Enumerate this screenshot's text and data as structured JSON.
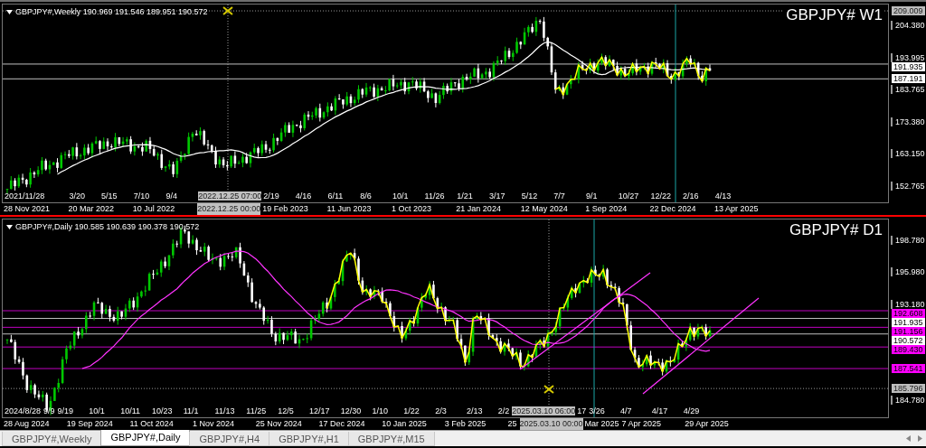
{
  "panels": [
    {
      "header": "GBPJPY#,Weekly 190.969 191.546 189.951 190.572",
      "symbol": "GBPJPY# W1",
      "active": false,
      "price_labels": [
        {
          "text": "209.009",
          "kind": "marker"
        },
        {
          "text": "204.380",
          "kind": "tick"
        },
        {
          "text": "193.995",
          "kind": "tick"
        },
        {
          "text": "191.935",
          "kind": "level",
          "color": "#ffffff"
        },
        {
          "text": "187.191",
          "kind": "level",
          "color": "#ffffff"
        },
        {
          "text": "183.765",
          "kind": "tick"
        },
        {
          "text": "173.380",
          "kind": "tick"
        },
        {
          "text": "163.150",
          "kind": "tick"
        },
        {
          "text": "152.765",
          "kind": "tick"
        }
      ],
      "inner_dates": [
        {
          "text": "2021/11/28",
          "kind": "wide"
        },
        {
          "text": "3/20",
          "kind": "date"
        },
        {
          "text": "5/15",
          "kind": "date"
        },
        {
          "text": "7/10",
          "kind": "date"
        },
        {
          "text": "9/4",
          "kind": "date"
        },
        {
          "text": "2022.12.25 07:00",
          "kind": "crosshair"
        },
        {
          "text": "2/19",
          "kind": "date"
        },
        {
          "text": "4/16",
          "kind": "date"
        },
        {
          "text": "6/11",
          "kind": "date"
        },
        {
          "text": "8/6",
          "kind": "date"
        },
        {
          "text": "10/1",
          "kind": "date"
        },
        {
          "text": "11/26",
          "kind": "date"
        },
        {
          "text": "1/21",
          "kind": "date"
        },
        {
          "text": "3/17",
          "kind": "date"
        },
        {
          "text": "5/12",
          "kind": "date"
        },
        {
          "text": "7/7",
          "kind": "date"
        },
        {
          "text": "9/1",
          "kind": "date"
        },
        {
          "text": "10/27",
          "kind": "date"
        },
        {
          "text": "12/22",
          "kind": "date"
        },
        {
          "text": "2/16",
          "kind": "date"
        },
        {
          "text": "4/13",
          "kind": "date"
        }
      ],
      "dates": [
        {
          "text": "28 Nov 2021",
          "kind": "date"
        },
        {
          "text": "20 Mar 2022",
          "kind": "date"
        },
        {
          "text": "10 Jul 2022",
          "kind": "date"
        },
        {
          "text": "2022.12.25 00:00",
          "kind": "crosshair"
        },
        {
          "text": "19 Feb 2023",
          "kind": "date"
        },
        {
          "text": "11 Jun 2023",
          "kind": "date"
        },
        {
          "text": "1 Oct 2023",
          "kind": "date"
        },
        {
          "text": "21 Jan 2024",
          "kind": "date"
        },
        {
          "text": "12 May 2024",
          "kind": "date"
        },
        {
          "text": "1 Sep 2024",
          "kind": "date"
        },
        {
          "text": "22 Dec 2024",
          "kind": "date"
        },
        {
          "text": "13 Apr 2025",
          "kind": "date"
        }
      ]
    },
    {
      "header": "GBPJPY#,Daily 190.585 190.639 190.378 190.572",
      "symbol": "GBPJPY# D1",
      "active": true,
      "price_labels": [
        {
          "text": "198.780",
          "kind": "tick"
        },
        {
          "text": "195.980",
          "kind": "tick"
        },
        {
          "text": "193.180",
          "kind": "tick"
        },
        {
          "text": "192.608",
          "kind": "level",
          "color": "#ff00ff"
        },
        {
          "text": "191.935",
          "kind": "level",
          "color": "#ffffff"
        },
        {
          "text": "191.156",
          "kind": "level",
          "color": "#ff00ff"
        },
        {
          "text": "190.572",
          "kind": "level",
          "color": "#ffffff"
        },
        {
          "text": "189.430",
          "kind": "level",
          "color": "#ff00ff"
        },
        {
          "text": "187.541",
          "kind": "level",
          "color": "#ff00ff"
        },
        {
          "text": "185.796",
          "kind": "marker"
        },
        {
          "text": "184.780",
          "kind": "tick"
        }
      ],
      "inner_dates": [
        {
          "text": "2024/8/28",
          "kind": "cut"
        },
        {
          "text": "9/9",
          "kind": "cut"
        },
        {
          "text": "9/19",
          "kind": "date"
        },
        {
          "text": "10/1",
          "kind": "date"
        },
        {
          "text": "10/11",
          "kind": "date"
        },
        {
          "text": "10/23",
          "kind": "date"
        },
        {
          "text": "11/1",
          "kind": "date"
        },
        {
          "text": "11/13",
          "kind": "date"
        },
        {
          "text": "11/25",
          "kind": "date"
        },
        {
          "text": "12/5",
          "kind": "date"
        },
        {
          "text": "12/17",
          "kind": "date"
        },
        {
          "text": "12/30",
          "kind": "date"
        },
        {
          "text": "1/10",
          "kind": "date"
        },
        {
          "text": "1/22",
          "kind": "date"
        },
        {
          "text": "2/3",
          "kind": "date"
        },
        {
          "text": "2/13",
          "kind": "date"
        },
        {
          "text": "2/2",
          "kind": "cut"
        },
        {
          "text": "2025.03.10 06:00",
          "kind": "crosshair"
        },
        {
          "text": "17",
          "kind": "cut"
        },
        {
          "text": "3/26",
          "kind": "date"
        },
        {
          "text": "4/7",
          "kind": "date"
        },
        {
          "text": "4/17",
          "kind": "date"
        },
        {
          "text": "4/29",
          "kind": "date"
        }
      ],
      "dates": [
        {
          "text": "28 Aug 2024",
          "kind": "date"
        },
        {
          "text": "19 Sep 2024",
          "kind": "date"
        },
        {
          "text": "11 Oct 2024",
          "kind": "date"
        },
        {
          "text": "1 Nov 2024",
          "kind": "date"
        },
        {
          "text": "25 Nov 2024",
          "kind": "date"
        },
        {
          "text": "17 Dec 2024",
          "kind": "date"
        },
        {
          "text": "10 Jan 2025",
          "kind": "date"
        },
        {
          "text": "3 Feb 2025",
          "kind": "date"
        },
        {
          "text": "25",
          "kind": "cut"
        },
        {
          "text": "2025.03.10 00:00",
          "kind": "crosshair"
        },
        {
          "text": "Mar 2025",
          "kind": "cut"
        },
        {
          "text": "7 Apr 2025",
          "kind": "date"
        },
        {
          "text": "29 Apr 2025",
          "kind": "date"
        }
      ]
    }
  ],
  "tabs": [
    {
      "label": "GBPJPY#,Weekly",
      "selected": false
    },
    {
      "label": "GBPJPY#,Daily",
      "selected": true
    },
    {
      "label": "GBPJPY#,H4",
      "selected": false
    },
    {
      "label": "GBPJPY#,H1",
      "selected": false
    },
    {
      "label": "GBPJPY#,M15",
      "selected": false
    }
  ]
}
